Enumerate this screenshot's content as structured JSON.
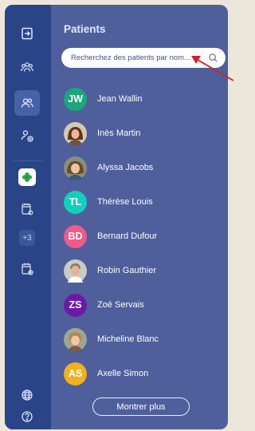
{
  "panel": {
    "title": "Patients",
    "search_placeholder": "Recherchez des patients par nom..."
  },
  "rail": {
    "extra_count_badge": "+3",
    "icons": [
      "exit-icon",
      "group-icon",
      "patients-icon",
      "add-user-icon",
      "clover-app-icon",
      "calendar-settings-icon",
      "calendar-add-icon",
      "globe-icon",
      "help-icon"
    ]
  },
  "patients": [
    {
      "name": "Jean Wallin",
      "initials": "JW",
      "color": "#1fa57c"
    },
    {
      "name": "Inès Martin",
      "initials": "",
      "photo": true
    },
    {
      "name": "Alyssa Jacobs",
      "initials": "",
      "photo": true
    },
    {
      "name": "Thérèse Louis",
      "initials": "TL",
      "color": "#12d0be"
    },
    {
      "name": "Bernard Dufour",
      "initials": "BD",
      "color": "#ee5a8c"
    },
    {
      "name": "Robin Gauthier",
      "initials": "",
      "photo": true
    },
    {
      "name": "Zoé Servais",
      "initials": "ZS",
      "color": "#6a1aa6"
    },
    {
      "name": "Micheline Blanc",
      "initials": "",
      "photo": true
    },
    {
      "name": "Axelle Simon",
      "initials": "AS",
      "color": "#f0b11f"
    }
  ],
  "show_more_label": "Montrer plus",
  "colors": {
    "rail": "#2b4487",
    "panel": "#4e5f9c",
    "annotation_arrow": "#d1202a"
  }
}
